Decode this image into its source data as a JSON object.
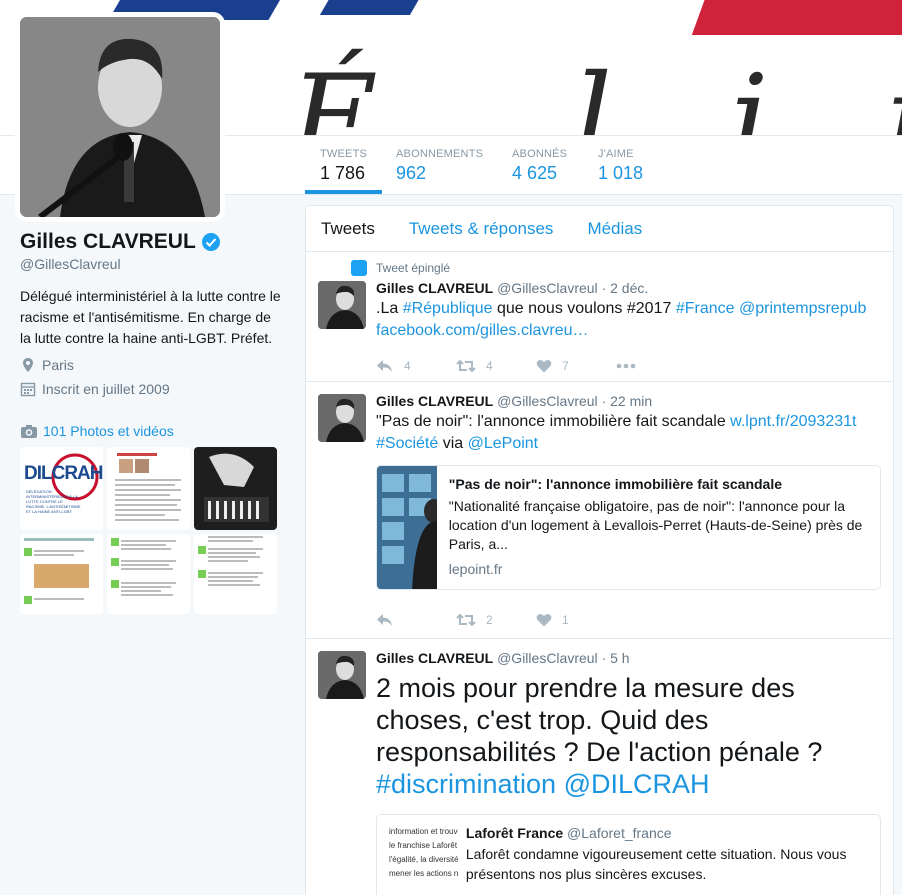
{
  "profile": {
    "name": "Gilles CLAVREUL",
    "handle": "@GillesClavreul",
    "bio": "Délégué interministériel à la lutte contre le racisme et l'antisémitisme. En charge de la lutte contre la haine anti-LGBT. Préfet.",
    "location": "Paris",
    "joined": "Inscrit en juillet 2009",
    "photos_link": "101 Photos et vidéos",
    "dilcrah_logo_text": "DILCRAH",
    "dilcrah_sub": "DÉLÉGATION INTERMINISTÉRIELLE À LA LUTTE CONTRE LE RACISME, L'ANTISÉMITISME ET LA HAINE ANTI-LGBT"
  },
  "stats": [
    {
      "label": "TWEETS",
      "value": "1 786"
    },
    {
      "label": "ABONNEMENTS",
      "value": "962"
    },
    {
      "label": "ABONNÉS",
      "value": "4 625"
    },
    {
      "label": "J'AIME",
      "value": "1 018"
    }
  ],
  "tabs": [
    "Tweets",
    "Tweets & réponses",
    "Médias"
  ],
  "tweets": [
    {
      "pinned_label": "Tweet épinglé",
      "name": "Gilles CLAVREUL",
      "handle": "@GillesClavreul",
      "time": "· 2 déc.",
      "text_parts": [
        ".La ",
        "#République",
        " que nous voulons #2017 ",
        "#France",
        " ",
        "@printempsrepub"
      ],
      "link": "facebook.com/gilles.clavreu…",
      "replies": "4",
      "retweets": "4",
      "likes": "7"
    },
    {
      "name": "Gilles CLAVREUL",
      "handle": "@GillesClavreul",
      "time": "· 22 min",
      "text_a": "\"Pas de noir\": l'annonce immobilière fait scandale ",
      "link": "w.lpnt.fr/2093231t",
      "hashtag": "#Société",
      "via": " via ",
      "mention": "@LePoint",
      "card": {
        "title": "\"Pas de noir\": l'annonce immobilière fait scandale",
        "description": "\"Nationalité française obligatoire, pas de noir\": l'annonce pour la location d'un logement à Levallois-Perret (Hauts-de-Seine) près de Paris, a...",
        "domain": "lepoint.fr"
      },
      "replies": "",
      "retweets": "2",
      "likes": "1"
    },
    {
      "name": "Gilles CLAVREUL",
      "handle": "@GillesClavreul",
      "time": "· 5 h",
      "text": "2 mois pour prendre la mesure des choses, c'est trop. Quid des responsabilités ? De l'action pénale ? ",
      "hashtag": "#discrimination",
      "mention": "@DILCRAH",
      "quote": {
        "name": "Laforêt France",
        "handle": "@Laforet_france",
        "text": "Laforêt condamne vigoureusement cette situation. Nous vous présentons nos plus sincères excuses.",
        "image_lines": [
          "information et trouvons cela to",
          "le franchise Laforêt condamn",
          "l'égalité, la diversité et le r",
          "mener les actions nécessair"
        ]
      }
    }
  ],
  "colors": {
    "accent": "#1b95e0",
    "verified": "#1da1f2",
    "text": "#14171a",
    "muted": "#657786"
  }
}
